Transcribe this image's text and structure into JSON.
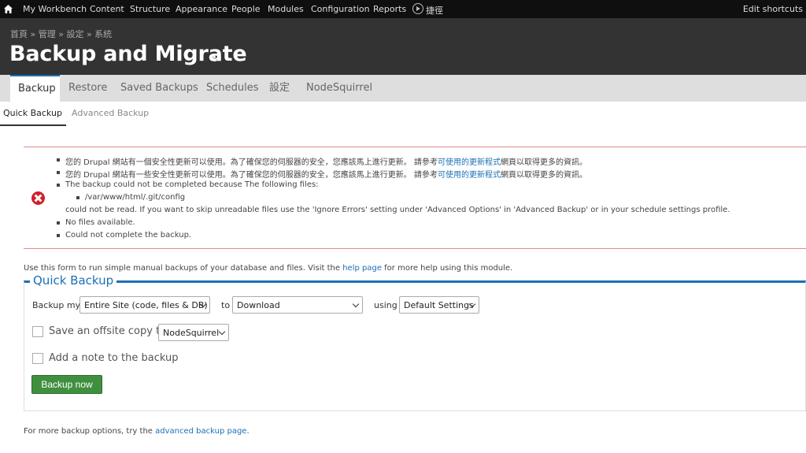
{
  "toolbar": {
    "items": [
      "My Workbench",
      "Content",
      "Structure",
      "Appearance",
      "People",
      "Modules",
      "Configuration",
      "Reports"
    ],
    "shortcuts_label": "捷徑",
    "edit_shortcuts": "Edit shortcuts"
  },
  "header": {
    "breadcrumb": "首頁 » 管理 » 設定 » 系統",
    "title": "Backup and Migrate"
  },
  "tabs": [
    "Backup",
    "Restore",
    "Saved Backups",
    "Schedules",
    "設定",
    "NodeSquirrel"
  ],
  "subtabs": [
    "Quick Backup",
    "Advanced Backup"
  ],
  "messages": {
    "m1_pre": "您的 Drupal 網站有一個安全性更新可以使用。為了確保您的伺服器的安全，您應該馬上進行更新。 請參考",
    "m1_link": "可使用的更新程式",
    "m1_post": "網頁以取得更多的資訊。",
    "m2_pre": "您的 Drupal 網站有一些安全性更新可以使用。為了確保您的伺服器的安全，您應該馬上進行更新。 請參考",
    "m2_link": "可使用的更新程式",
    "m2_post": "網頁以取得更多的資訊。",
    "m3": "The backup could not be completed because The following files:",
    "m3_file": "/var/www/html/.git/config",
    "m3_cont": "could not be read. If you want to skip unreadable files use the 'Ignore Errors' setting under 'Advanced Options' in 'Advanced Backup' or in your schedule settings profile.",
    "m4": "No files available.",
    "m5": "Could not complete the backup."
  },
  "intro": {
    "pre": "Use this form to run simple manual backups of your database and files. Visit the ",
    "link": "help page",
    "post": " for more help using this module."
  },
  "quick_backup": {
    "legend": "Quick Backup",
    "backup_my_label": "Backup my",
    "source_value": "Entire Site (code, files & DB)",
    "to_label": "to",
    "destination_value": "Download",
    "using_label": "using",
    "profile_value": "Default Settings",
    "offsite_label": "Save an offsite copy to",
    "offsite_value": "NodeSquirrel",
    "note_label": "Add a note to the backup",
    "submit_label": "Backup now"
  },
  "footer": {
    "pre": "For more backup options, try the ",
    "link": "advanced backup page",
    "post": "."
  }
}
